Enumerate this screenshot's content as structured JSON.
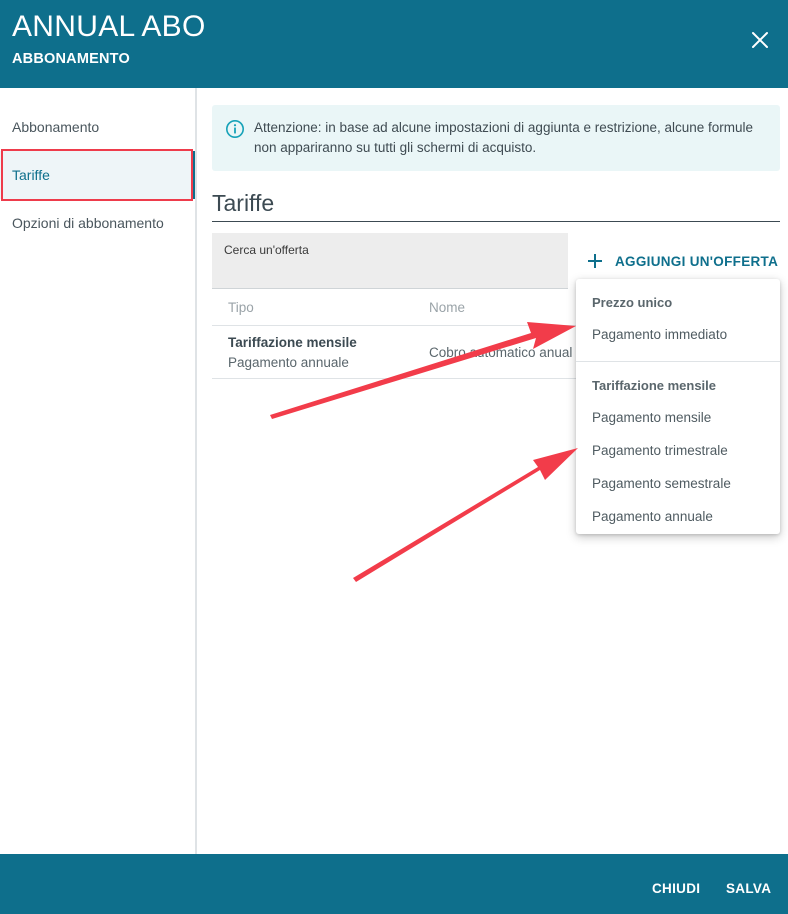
{
  "header": {
    "title": "ANNUAL ABO",
    "subtitle": "ABBONAMENTO"
  },
  "sidebar": {
    "items": [
      {
        "label": "Abbonamento"
      },
      {
        "label": "Tariffe"
      },
      {
        "label": "Opzioni di abbonamento"
      }
    ]
  },
  "info": {
    "text": "Attenzione: in base ad alcune impostazioni di aggiunta e restrizione, alcune formule non appariranno su tutti gli schermi di acquisto."
  },
  "section": {
    "title": "Tariffe"
  },
  "search": {
    "label": "Cerca un'offerta"
  },
  "add_button": {
    "label": "AGGIUNGI UN'OFFERTA"
  },
  "table": {
    "headers": [
      "Tipo",
      "Nome"
    ],
    "rows": [
      {
        "type": "Tariffazione mensile",
        "subtype": "Pagamento annuale",
        "name": "Cobro automatico anual"
      }
    ]
  },
  "dropdown": {
    "groups": [
      {
        "title": "Prezzo unico",
        "items": [
          "Pagamento immediato"
        ]
      },
      {
        "title": "Tariffazione mensile",
        "items": [
          "Pagamento mensile",
          "Pagamento trimestrale",
          "Pagamento semestrale",
          "Pagamento annuale"
        ]
      }
    ]
  },
  "footer": {
    "close_label": "CHIUDI",
    "save_label": "SALVA"
  },
  "colors": {
    "brand": "#0e6f8c",
    "annotation": "#ee3b4b",
    "info_bg": "#eaf6f7"
  }
}
